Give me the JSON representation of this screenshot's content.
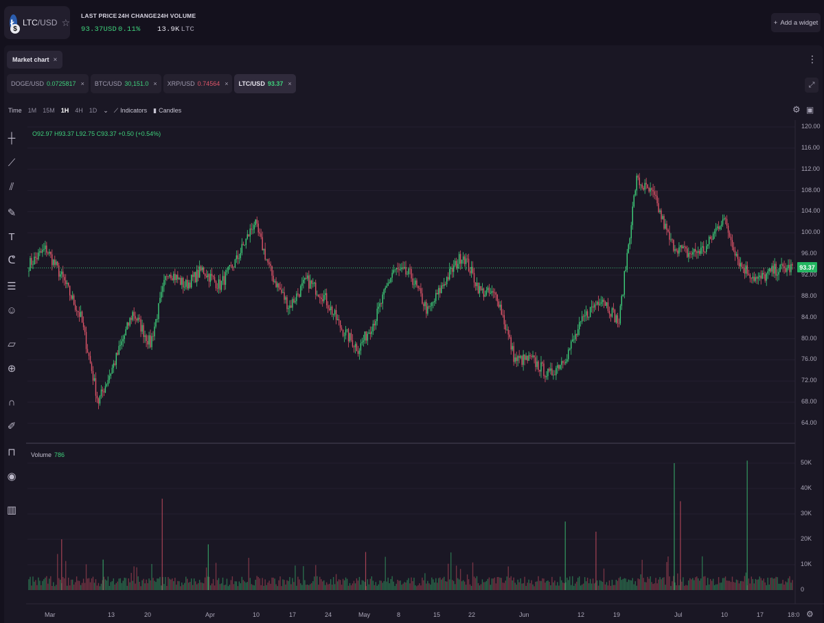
{
  "header": {
    "pair_base": "LTC",
    "pair_quote": "/USD",
    "stats": [
      {
        "label": "LAST PRICE",
        "value": "93.37",
        "unit": "USD"
      },
      {
        "label": "24H CHANGE",
        "value": "0.11%",
        "unit": ""
      },
      {
        "label": "24H VOLUME",
        "value": "13.9K",
        "unit": "LTC"
      }
    ],
    "add_widget": "Add a widget"
  },
  "panel": {
    "tab_label": "Market chart",
    "tickers": [
      {
        "pair": "DOGE/USD",
        "price": "0.0725817",
        "dir": "up"
      },
      {
        "pair": "BTC/USD",
        "price": "30,151.0",
        "dir": "up"
      },
      {
        "pair": "XRP/USD",
        "price": "0.74564",
        "dir": "down"
      },
      {
        "pair": "LTC/USD",
        "price": "93.37",
        "dir": "up"
      }
    ]
  },
  "toolbar": {
    "time_label": "Time",
    "timeframes": [
      "1M",
      "15M",
      "1H",
      "4H",
      "1D"
    ],
    "active_timeframe": "1H",
    "indicators_label": "Indicators",
    "candles_label": "Candles"
  },
  "ohlc_text": "O92.97 H93.37 L92.75 C93.37 +0.50 (+0.54%)",
  "volume_label": "Volume",
  "volume_value": "786",
  "current_price_tag": "93.37",
  "chart_data": {
    "type": "candlestick",
    "price_axis": [
      "120.00",
      "116.00",
      "112.00",
      "108.00",
      "104.00",
      "100.00",
      "96.00",
      "92.00",
      "88.00",
      "84.00",
      "80.00",
      "76.00",
      "72.00",
      "68.00",
      "64.00"
    ],
    "volume_axis": [
      "50K",
      "40K",
      "30K",
      "20K",
      "10K",
      "0"
    ],
    "x_labels": [
      "Mar",
      "13",
      "20",
      "Apr",
      "10",
      "17",
      "24",
      "May",
      "8",
      "15",
      "22",
      "Jun",
      "12",
      "19",
      "Jul",
      "10",
      "17",
      "18:0"
    ],
    "current_price": 93.37,
    "price_range": [
      62,
      122
    ],
    "close_profile": [
      {
        "t": "Mar",
        "v": 94
      },
      {
        "t": "Mar 5",
        "v": 97
      },
      {
        "t": "Mar 7",
        "v": 91
      },
      {
        "t": "Mar 10",
        "v": 84
      },
      {
        "t": "Mar 12",
        "v": 68
      },
      {
        "t": "Mar 14",
        "v": 76
      },
      {
        "t": "Mar 17",
        "v": 85
      },
      {
        "t": "Mar 21",
        "v": 79
      },
      {
        "t": "Mar 24",
        "v": 93
      },
      {
        "t": "Mar 28",
        "v": 90
      },
      {
        "t": "Apr 3",
        "v": 93
      },
      {
        "t": "Apr 8",
        "v": 90
      },
      {
        "t": "Apr 12",
        "v": 95
      },
      {
        "t": "Apr 16",
        "v": 102
      },
      {
        "t": "Apr 18",
        "v": 92
      },
      {
        "t": "Apr 22",
        "v": 86
      },
      {
        "t": "Apr 26",
        "v": 91
      },
      {
        "t": "May 1",
        "v": 88
      },
      {
        "t": "May 6",
        "v": 82
      },
      {
        "t": "May 9",
        "v": 78
      },
      {
        "t": "May 12",
        "v": 84
      },
      {
        "t": "May 15",
        "v": 93
      },
      {
        "t": "May 19",
        "v": 92
      },
      {
        "t": "May 23",
        "v": 85
      },
      {
        "t": "May 27",
        "v": 91
      },
      {
        "t": "Jun 1",
        "v": 96
      },
      {
        "t": "Jun 4",
        "v": 89
      },
      {
        "t": "Jun 7",
        "v": 88
      },
      {
        "t": "Jun 10",
        "v": 76
      },
      {
        "t": "Jun 13",
        "v": 76
      },
      {
        "t": "Jun 15",
        "v": 73
      },
      {
        "t": "Jun 18",
        "v": 77
      },
      {
        "t": "Jun 21",
        "v": 84
      },
      {
        "t": "Jun 24",
        "v": 88
      },
      {
        "t": "Jun 28",
        "v": 83
      },
      {
        "t": "Jul 1",
        "v": 110
      },
      {
        "t": "Jul 3",
        "v": 107
      },
      {
        "t": "Jul 5",
        "v": 98
      },
      {
        "t": "Jul 9",
        "v": 96
      },
      {
        "t": "Jul 12",
        "v": 97
      },
      {
        "t": "Jul 14",
        "v": 103
      },
      {
        "t": "Jul 15",
        "v": 94
      },
      {
        "t": "Jul 18",
        "v": 91
      },
      {
        "t": "Jul 21",
        "v": 93
      },
      {
        "t": "Jul 23",
        "v": 93.37
      }
    ],
    "volume_peaks": [
      {
        "t": "Mar 4",
        "v": 20000
      },
      {
        "t": "Mar 13",
        "v": 12000
      },
      {
        "t": "Mar 23",
        "v": 36000
      },
      {
        "t": "Apr 3",
        "v": 18000
      },
      {
        "t": "May 1",
        "v": 15000
      },
      {
        "t": "Jun 10",
        "v": 27000
      },
      {
        "t": "Jun 17",
        "v": 23000
      },
      {
        "t": "Jul 1",
        "v": 50000
      },
      {
        "t": "Jul 3",
        "v": 35000
      },
      {
        "t": "Jul 14",
        "v": 51000
      }
    ],
    "colors": {
      "up": "#3fd27c",
      "down": "#e2566a",
      "bg": "#1a1724"
    }
  }
}
